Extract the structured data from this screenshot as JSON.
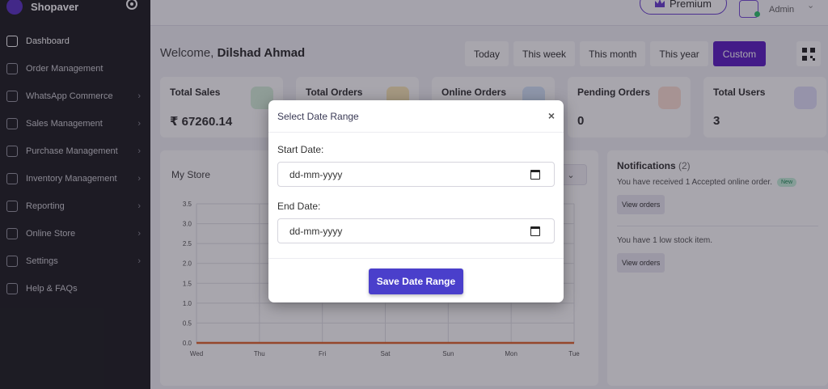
{
  "brand": {
    "name": "Shopaver"
  },
  "sidebar": {
    "items": [
      {
        "label": "Dashboard"
      },
      {
        "label": "Order Management"
      },
      {
        "label": "WhatsApp Commerce",
        "chevron": "›"
      },
      {
        "label": "Sales Management",
        "chevron": "›"
      },
      {
        "label": "Purchase Management",
        "chevron": "›"
      },
      {
        "label": "Inventory Management",
        "chevron": "›"
      },
      {
        "label": "Reporting",
        "chevron": "›"
      },
      {
        "label": "Online Store",
        "chevron": "›"
      },
      {
        "label": "Settings",
        "chevron": "›"
      },
      {
        "label": "Help & FAQs"
      }
    ]
  },
  "header": {
    "premium_label": "Premium",
    "user_label": "Admin",
    "chevron": "⌄"
  },
  "welcome": {
    "prefix": "Welcome,",
    "name": "Dilshad Ahmad"
  },
  "filters": {
    "today": "Today",
    "week": "This week",
    "month": "This month",
    "year": "This year",
    "custom": "Custom"
  },
  "cards": [
    {
      "title": "Total Sales",
      "value": "₹ 67260.14",
      "color": "#d7f0dc"
    },
    {
      "title": "Total Orders",
      "value": "",
      "color": "#fbe8b8"
    },
    {
      "title": "Online Orders",
      "value": "",
      "color": "#d6e6fb"
    },
    {
      "title": "Pending Orders",
      "value": "0",
      "color": "#fde0d6"
    },
    {
      "title": "Total Users",
      "value": "3",
      "color": "#e3e1fb"
    }
  ],
  "store": {
    "title": "My Store",
    "select_chevron": "⌄"
  },
  "chart_data": {
    "type": "line",
    "title": "",
    "xlabel": "",
    "ylabel": "",
    "categories": [
      "Wed",
      "Thu",
      "Fri",
      "Sat",
      "Sun",
      "Mon",
      "Tue"
    ],
    "y_ticks": [
      "0.0",
      "0.5",
      "1.0",
      "1.5",
      "2.0",
      "2.5",
      "3.0",
      "3.5"
    ],
    "ylim": [
      0,
      3.5
    ],
    "grid": true,
    "series": [
      {
        "values": [
          0,
          0,
          0,
          0,
          0,
          0,
          0
        ],
        "color": "#e0662f"
      }
    ]
  },
  "notifications": {
    "title": "Notifications",
    "count": "(2)",
    "items": [
      {
        "message": "You have received 1 Accepted online order.",
        "badge": "New",
        "button": "View orders"
      },
      {
        "message": "You have 1 low stock item.",
        "button": "View orders"
      }
    ]
  },
  "modal": {
    "title": "Select Date Range",
    "close": "×",
    "start_label": "Start Date:",
    "start_value": "dd-mm-yyyy",
    "end_label": "End Date:",
    "end_value": "dd-mm-yyyy",
    "save_label": "Save Date Range"
  }
}
